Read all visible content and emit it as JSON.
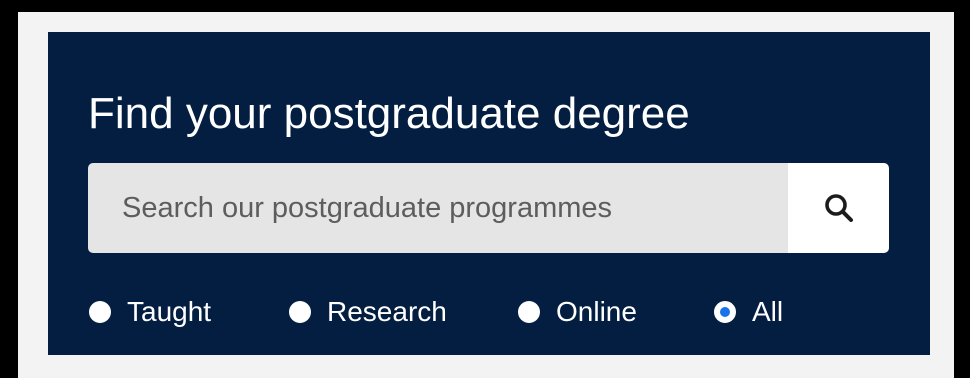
{
  "search_panel": {
    "title": "Find your postgraduate degree",
    "search": {
      "value": "",
      "placeholder": "Search our postgraduate programmes",
      "button_icon": "search-icon"
    },
    "filters": [
      {
        "label": "Taught",
        "selected": false
      },
      {
        "label": "Research",
        "selected": false
      },
      {
        "label": "Online",
        "selected": false
      },
      {
        "label": "All",
        "selected": true
      }
    ]
  },
  "colors": {
    "panel_background": "#041e42",
    "page_background": "#f3f3f3",
    "input_background": "#e5e5e5",
    "radio_selected": "#1a73e8",
    "text": "#ffffff"
  }
}
